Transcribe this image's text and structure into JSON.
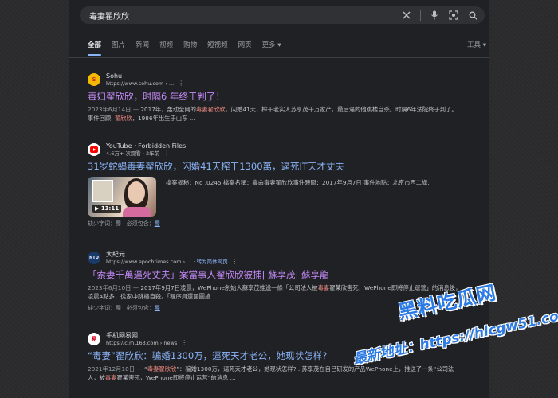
{
  "search": {
    "query": "毒妻翟欣欣"
  },
  "tabs": [
    {
      "label": "全部",
      "active": true
    },
    {
      "label": "图片"
    },
    {
      "label": "新闻"
    },
    {
      "label": "视频"
    },
    {
      "label": "购物"
    },
    {
      "label": "短视频"
    },
    {
      "label": "网页"
    },
    {
      "label": "更多 ▾"
    }
  ],
  "tools_label": "工具 ▾",
  "results": [
    {
      "source": "Sohu",
      "favicon_text": "S",
      "favicon_bg": "#f5b800",
      "favicon_fg": "#c0392b",
      "url": "https://www.sohu.com › ...",
      "title": "毒妇翟欣欣，时隔6 年终于判了！",
      "snippet_date": "2023年6月14日 — ",
      "snippet_a": "2017年，轰动全网的",
      "snippet_hl1": "毒妻翟欣欣",
      "snippet_b": "，闪婚41天，榨干老实人苏享茂千万家产，最后逼的他跳楼自杀。时隔6年法院终于判了。事件回顾. ",
      "snippet_hl2": "翟欣欣",
      "snippet_c": "，1986年出生于山东 ..."
    },
    {
      "source": "YouTube · Forbidden Files",
      "favicon_bg": "#ffffff",
      "meta": "4.6万+ 次观看 · 2年前",
      "title": "31岁蛇蝎毒妻翟欣欣，闪婚41天榨干1300萬，逼死IT天才丈夫",
      "thumb_label": "▶ 13:11",
      "snippet_a": "檔案揭秘：No .0245 檔案名稱：毒命毒妻翟欣欣事件時間：2017年9月7日 事件地點：北京市西二旗.",
      "missing_label": "缺少字词：",
      "missing_terms": "蜀",
      "missing_sep": " | 必须包含：",
      "missing_link": "蜀"
    },
    {
      "source": "大紀元",
      "favicon_text": "NTD",
      "favicon_bg": "#1a3a6a",
      "favicon_fg": "#ffffff",
      "url": "https://www.epochtimes.com › ...",
      "translate": " · 转为简体网页",
      "title": "「索妻千萬逼死丈夫」案當事人翟欣欣被捕| 蘇享茂| 蘇享龍",
      "snippet_date": "2023年6月10日 — ",
      "snippet_a": "2017年9月7日凌晨，WePhone創始人蘇享茂推送一條「公司法人被",
      "snippet_hl1": "毒妻",
      "snippet_b": "翟某欣害死，WePhone即將停止運營」的消息後，凌晨4點多，從家中跳樓自殺。「程序員還國圖搶 ...",
      "missing_label": "缺少字词：",
      "missing_terms": "蜀",
      "missing_sep": " | 必须包含：",
      "missing_link": "蜀"
    },
    {
      "source": "手机网易网",
      "favicon_text": "易",
      "favicon_bg": "#ffffff",
      "favicon_fg": "#d2001f",
      "url": "https://c.m.163.com › news",
      "title": "“毒妻”翟欣欣：骗婚1300万，逼死天才老公，她现状怎样?",
      "snippet_date": "2021年12月10日 — ",
      "snippet_a": "“",
      "snippet_hl1": "毒妻翟欣欣",
      "snippet_b": "”：骗婚1300万，逼死天才老公，她现状怎样? . 苏享茂在自己研发的产品WePhone上，推送了一条“公司法人，被",
      "snippet_hl2": "毒妻",
      "snippet_c": "翟某害死，WePhone即将停止运营”的消息 ..."
    }
  ],
  "watermark": {
    "line1": "黑料吃瓜网",
    "line2": "最新地址：https://hlcgw51.com"
  },
  "colors": {
    "bg": "#202124",
    "visited_title": "#c58af9",
    "link_title": "#8ab4f8",
    "highlight": "#f28b82",
    "watermark": "#2c7be5"
  }
}
